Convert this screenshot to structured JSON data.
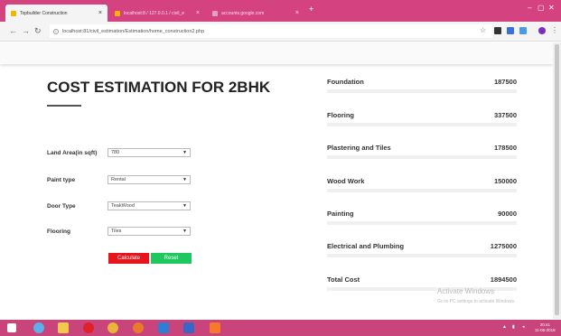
{
  "browser": {
    "tabs": [
      {
        "label": "Topbuilder Construction",
        "favicon_color": "#f4b400"
      },
      {
        "label": "localhost:8 / 127.0.0.1 / civil_e",
        "favicon_color": "#f4b400"
      },
      {
        "label": "accounts.google.com",
        "favicon_color": "#e0a0c0"
      }
    ],
    "url": "localhost:81/civil_estimation/Estimation/home_construction2.php"
  },
  "form": {
    "title": "COST ESTIMATION FOR 2BHK",
    "fields": [
      {
        "label": "Land Area(in sqft)",
        "value": "780"
      },
      {
        "label": "Paint type",
        "value": "Rental"
      },
      {
        "label": "Door Type",
        "value": "TeakWood"
      },
      {
        "label": "Flooring",
        "value": "Tiles"
      }
    ],
    "calculate_label": "Calculate",
    "reset_label": "Reset"
  },
  "costs": [
    {
      "name": "Foundation",
      "amount": "187500"
    },
    {
      "name": "Flooring",
      "amount": "337500"
    },
    {
      "name": "Plastering and Tiles",
      "amount": "178500"
    },
    {
      "name": "Wood Work",
      "amount": "150000"
    },
    {
      "name": "Painting",
      "amount": "90000"
    },
    {
      "name": "Electrical and Plumbing",
      "amount": "1275000"
    },
    {
      "name": "Total Cost",
      "amount": "1894500"
    }
  ],
  "watermark": {
    "line1": "Activate Windows",
    "line2": "Go to PC settings to activate Windows."
  },
  "taskbar": {
    "time": "20:41",
    "date": "11-05-2018"
  },
  "colors": {
    "accent_pink": "#d4437f",
    "calculate": "#e8141c",
    "reset": "#1fc75f"
  }
}
